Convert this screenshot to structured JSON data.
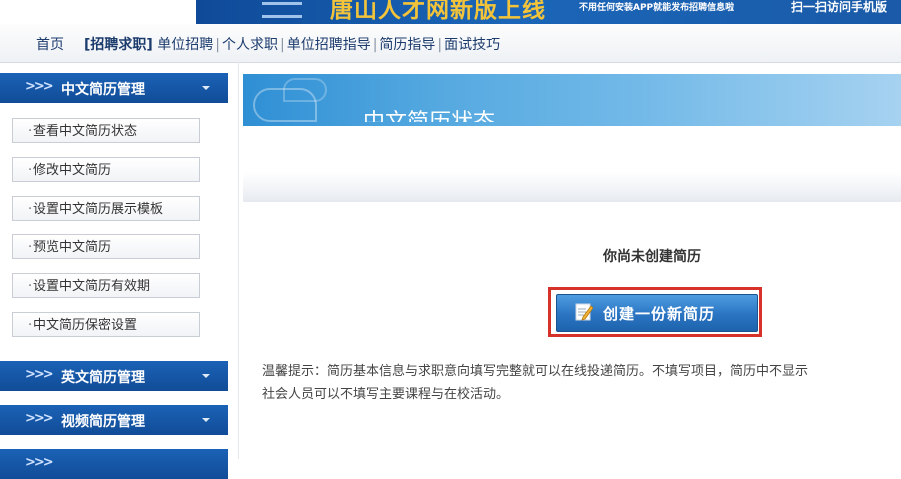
{
  "banner": {
    "title": "唐山人才网新版上线",
    "subtitle": "不用任何安装APP就能发布招聘信息啦",
    "qr_text": "扫一扫访问手机版"
  },
  "nav": {
    "items": [
      {
        "label": "首页"
      },
      {
        "label": "招聘求职",
        "active": true
      },
      {
        "label": "单位招聘"
      },
      {
        "label": "个人求职"
      },
      {
        "label": "单位招聘指导"
      },
      {
        "label": "简历指导"
      },
      {
        "label": "面试技巧"
      }
    ]
  },
  "sidebar": {
    "sections": [
      {
        "title": "中文简历管理",
        "items": [
          "查看中文简历状态",
          "修改中文简历",
          "设置中文简历展示模板",
          "预览中文简历",
          "设置中文简历有效期",
          "中文简历保密设置"
        ]
      },
      {
        "title": "英文简历管理"
      },
      {
        "title": "视频简历管理"
      }
    ]
  },
  "main": {
    "title": "中文简历状态",
    "empty_message": "你尚未创建简历",
    "create_button": "创建一份新简历",
    "tip_line1": "温馨提示：简历基本信息与求职意向填写完整就可以在线投递简历。不填写项目，简历中不显示",
    "tip_line2": "社会人员可以不填写主要课程与在校活动。"
  },
  "colors": {
    "sidebar_header": "#114c97",
    "main_header": "#55a9e0",
    "highlight": "#d6322a",
    "banner_title": "#f3c43a"
  }
}
